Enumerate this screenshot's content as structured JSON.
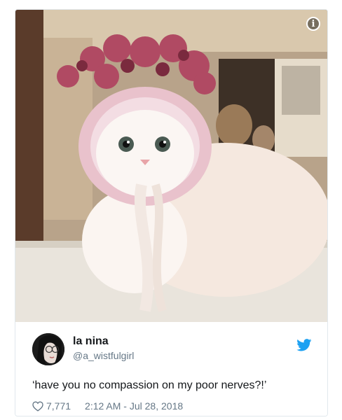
{
  "tweet": {
    "display_name": "la nina",
    "handle": "@a_wistfulgirl",
    "text": "‘have you no compassion on my poor nerves?!’",
    "likes": "7,771",
    "timestamp": "2:12 AM - Jul 28, 2018"
  },
  "icons": {
    "info": "i",
    "info_name": "info-icon",
    "bird_name": "twitter-bird-icon",
    "heart_name": "heart-icon"
  },
  "colors": {
    "brand": "#1da1f2",
    "text": "#14171a",
    "secondary": "#657786",
    "border": "#e1e8ed"
  }
}
